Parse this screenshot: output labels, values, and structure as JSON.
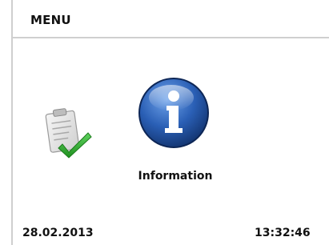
{
  "header": {
    "title": "MENU"
  },
  "menu": {
    "items": [
      {
        "icon": "clipboard-check-icon",
        "label": ""
      },
      {
        "icon": "info-icon",
        "label": "Information"
      }
    ]
  },
  "status": {
    "date": "28.02.2013",
    "time": "13:32:46"
  },
  "colors": {
    "info_blue": "#1f56a8",
    "check_green": "#2fa82f",
    "border_gray": "#cfcfcf"
  }
}
